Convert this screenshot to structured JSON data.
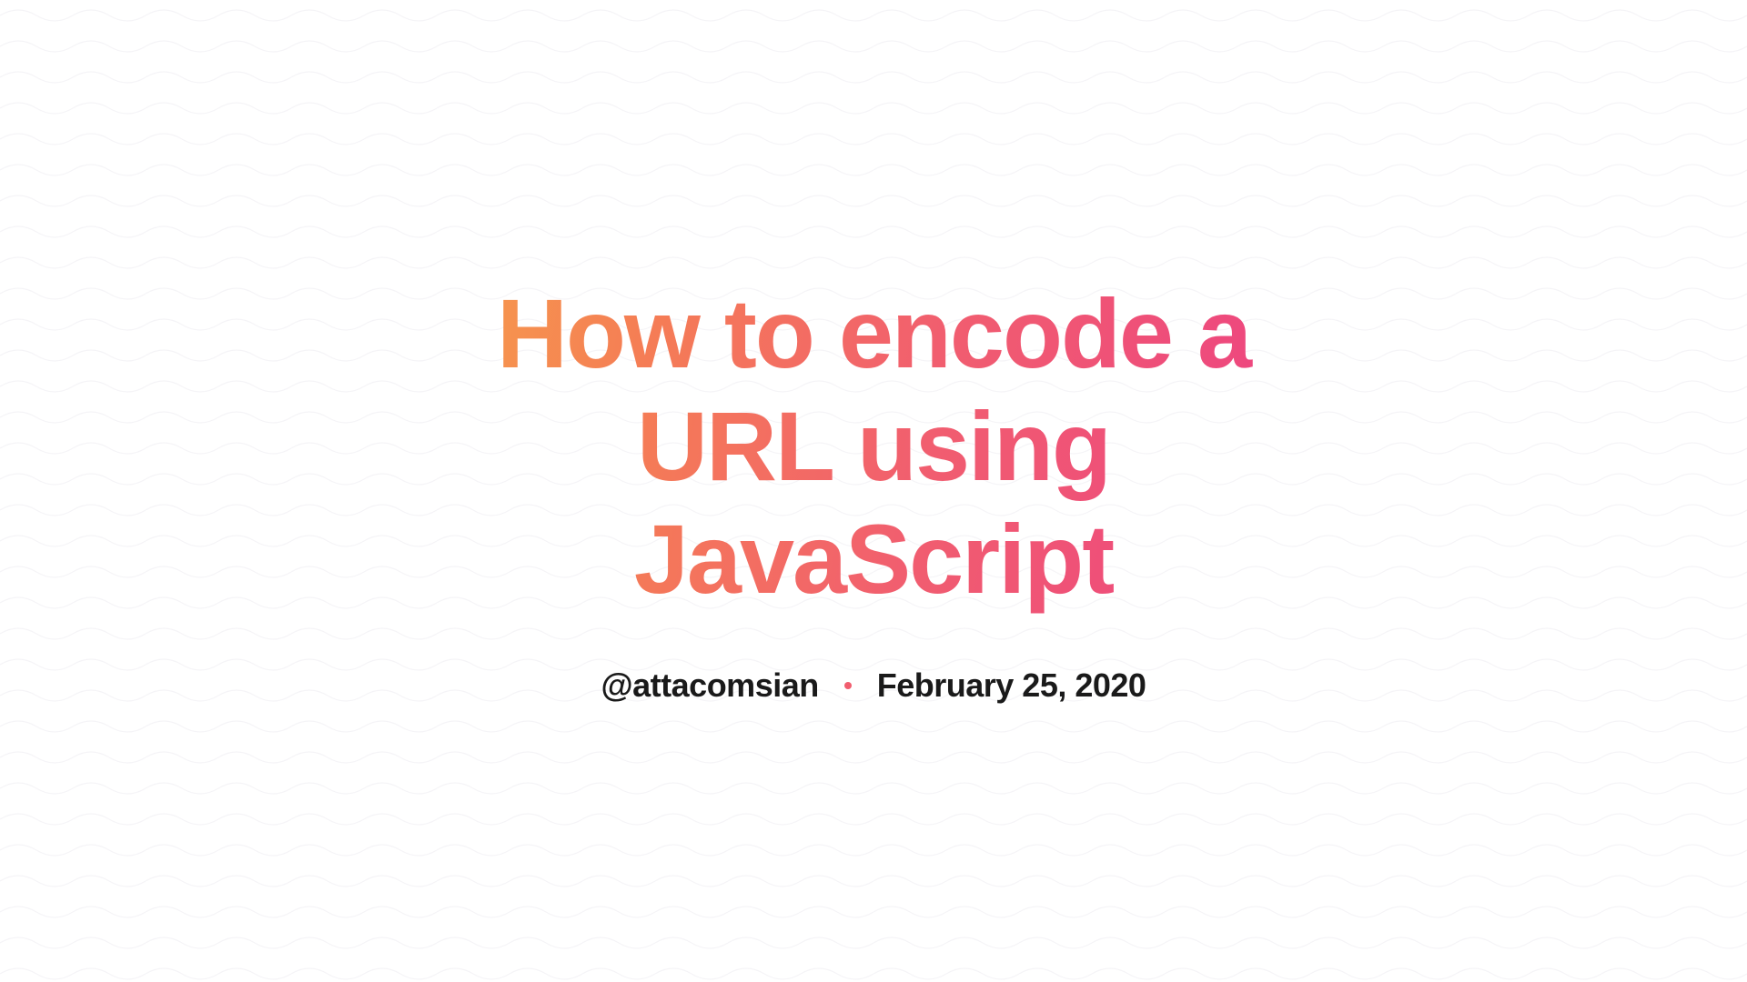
{
  "title": "How to encode a URL using JavaScript",
  "author": "@attacomsian",
  "date": "February 25, 2020"
}
